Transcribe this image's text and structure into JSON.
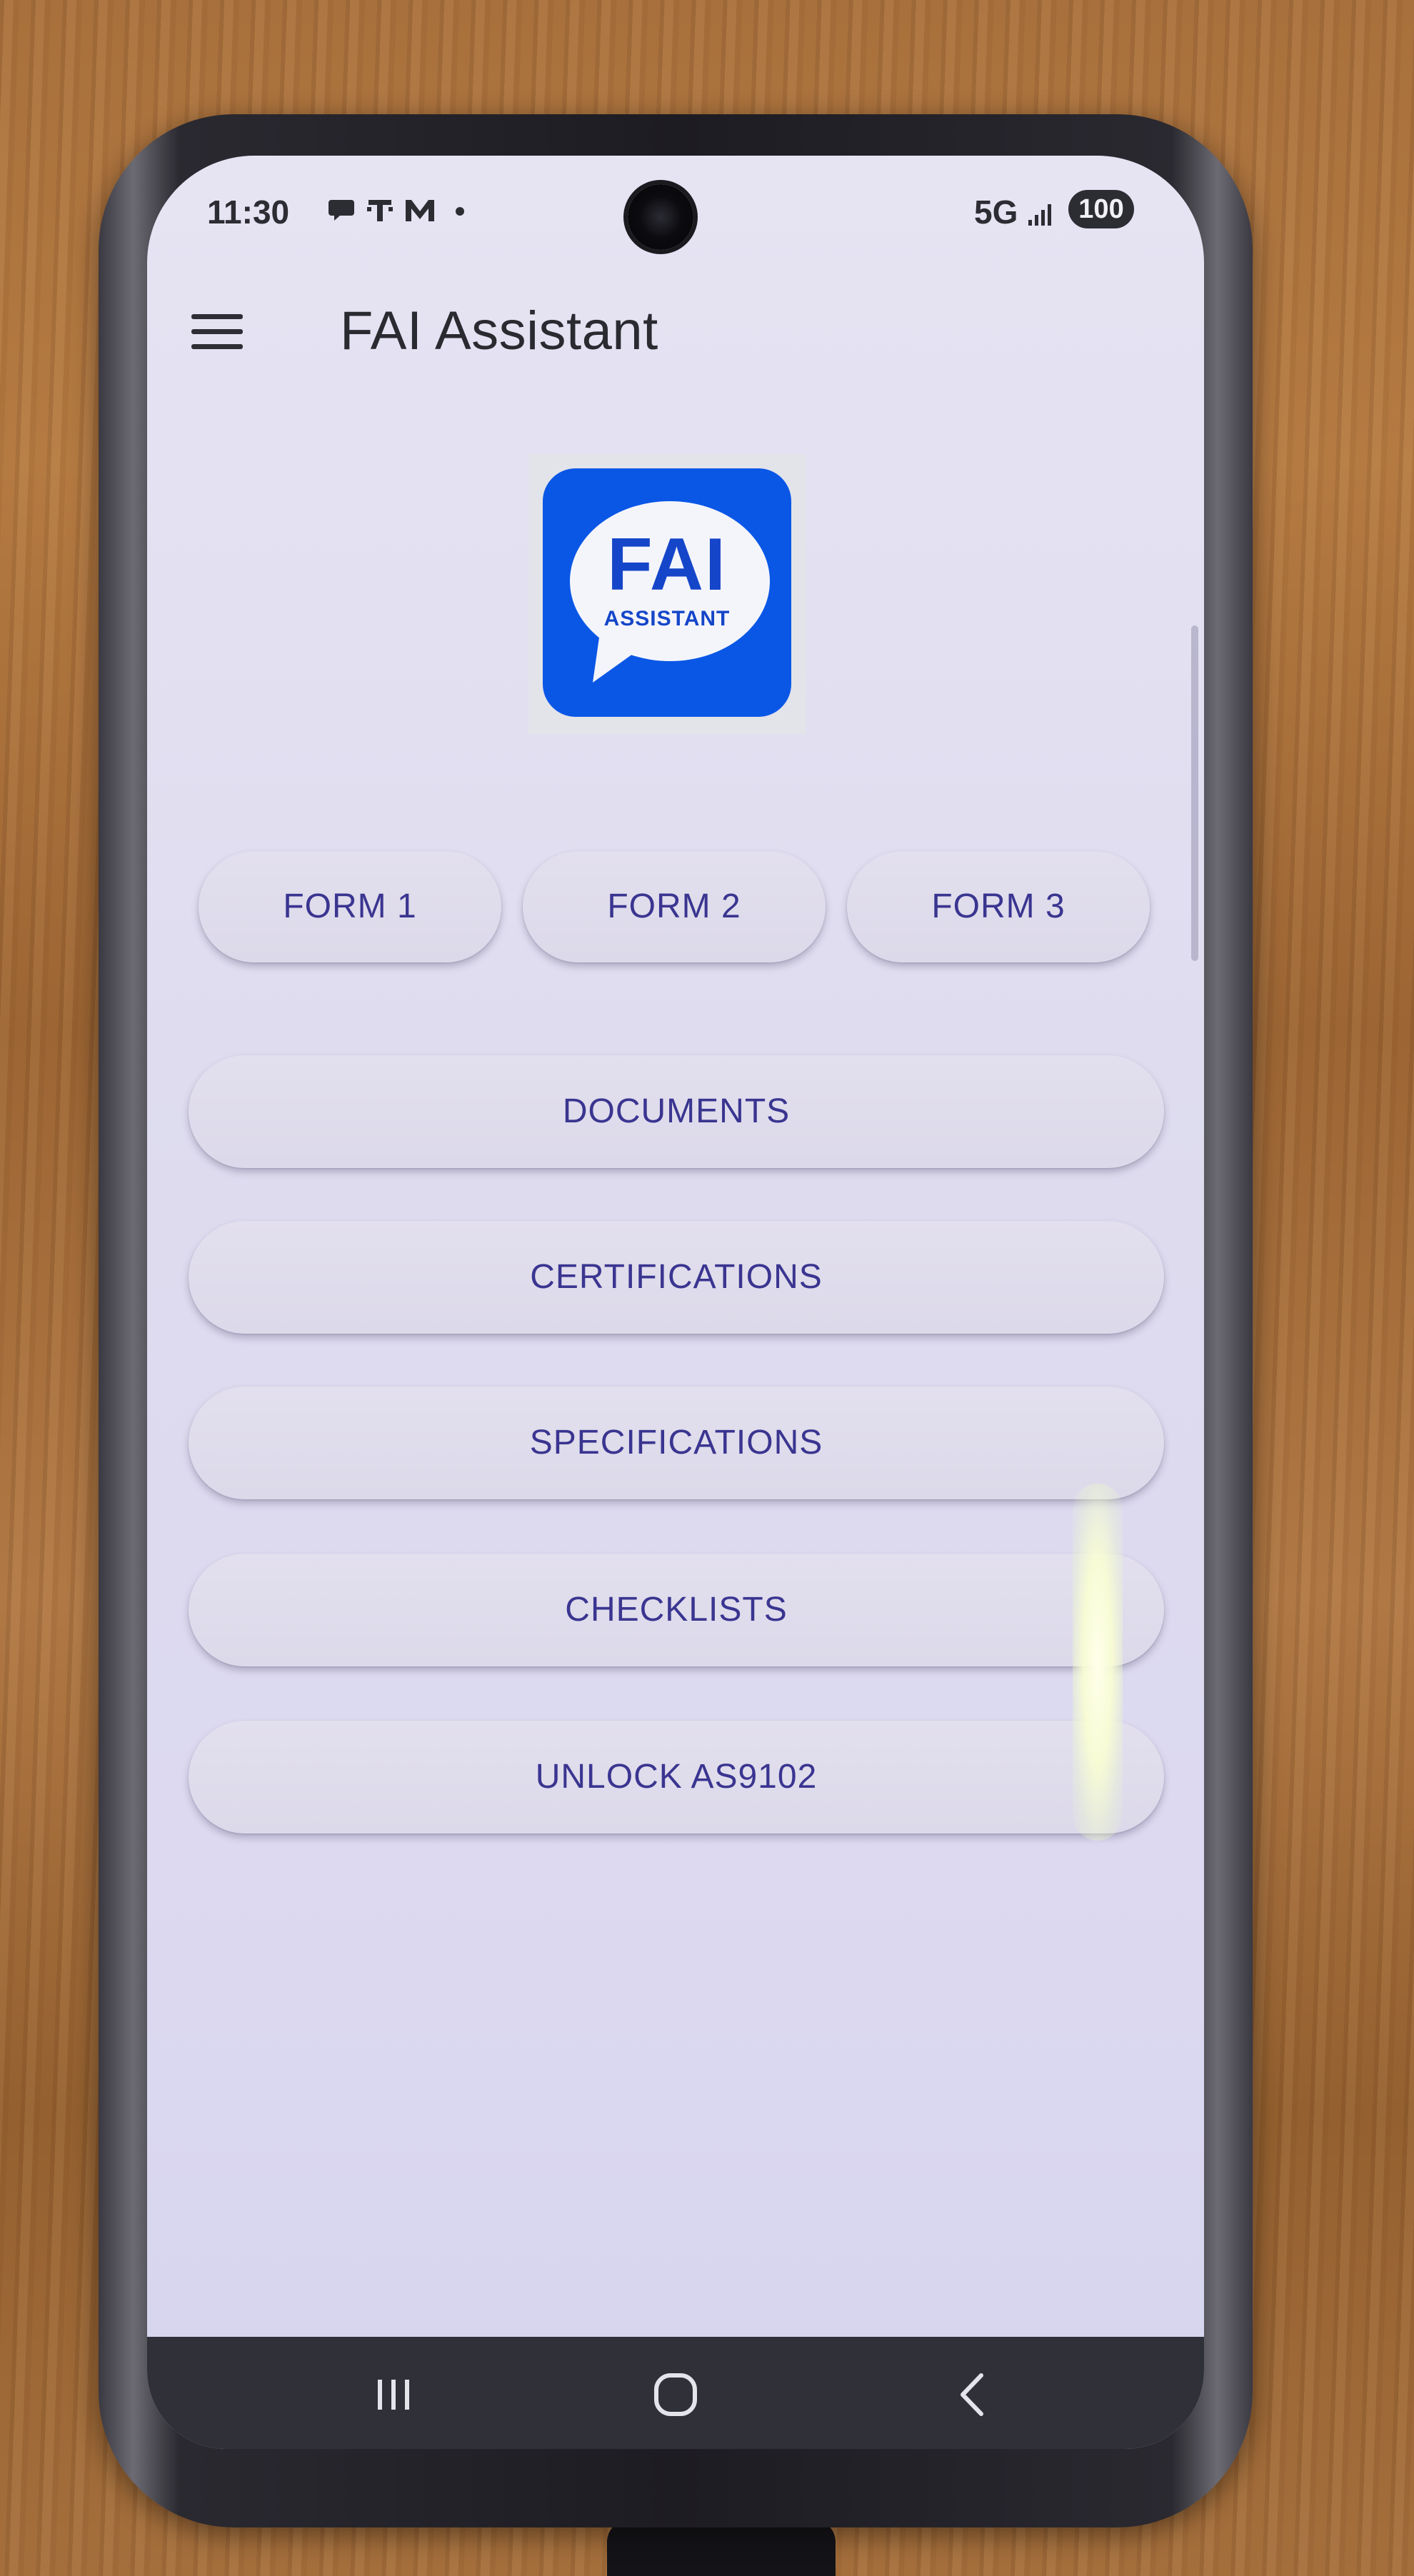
{
  "status_bar": {
    "time": "11:30",
    "icons": [
      "chat-bubble-icon",
      "t-mobile-icon",
      "gmail-icon",
      "notification-dot-icon"
    ],
    "network": "5G",
    "battery": "100"
  },
  "app_bar": {
    "menu_icon": "hamburger-menu-icon",
    "title": "FAI Assistant"
  },
  "logo": {
    "line1": "FAI",
    "line2": "ASSISTANT",
    "colors": {
      "background": "#0a57e6",
      "bubble": "#f4f5fb",
      "text": "#1546c9"
    }
  },
  "form_buttons": [
    {
      "label": "FORM 1"
    },
    {
      "label": "FORM 2"
    },
    {
      "label": "FORM 3"
    }
  ],
  "menu_buttons": [
    {
      "label": "DOCUMENTS"
    },
    {
      "label": "CERTIFICATIONS"
    },
    {
      "label": "SPECIFICATIONS"
    },
    {
      "label": "CHECKLISTS"
    },
    {
      "label": "UNLOCK AS9102"
    }
  ],
  "nav_bar": {
    "buttons": [
      "recents-icon",
      "home-icon",
      "back-icon"
    ]
  },
  "colors": {
    "button_text": "#3a3590",
    "screen_background": "#e0ddf0",
    "nav_background": "#2f3038"
  }
}
